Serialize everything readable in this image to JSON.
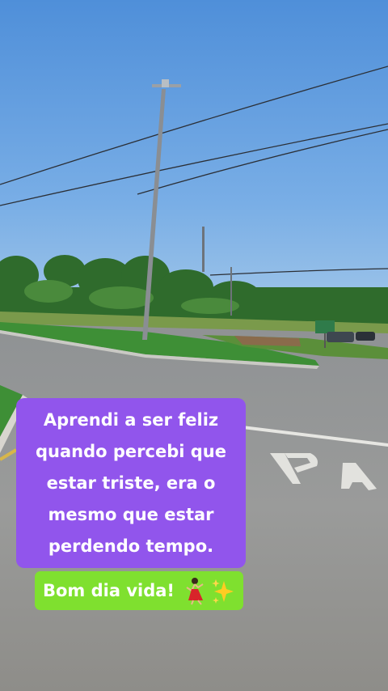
{
  "caption": {
    "lines": [
      "Aprendi a ser feliz",
      "quando percebi que",
      "estar triste, era o",
      "mesmo que estar",
      "perdendo tempo."
    ],
    "box_color": "#9155ec"
  },
  "greeting": {
    "text": "Bom dia vida!",
    "emojis": [
      "dancer-icon",
      "sparkles-icon"
    ],
    "box_color": "#7fe02f"
  },
  "road_marking": "P A"
}
